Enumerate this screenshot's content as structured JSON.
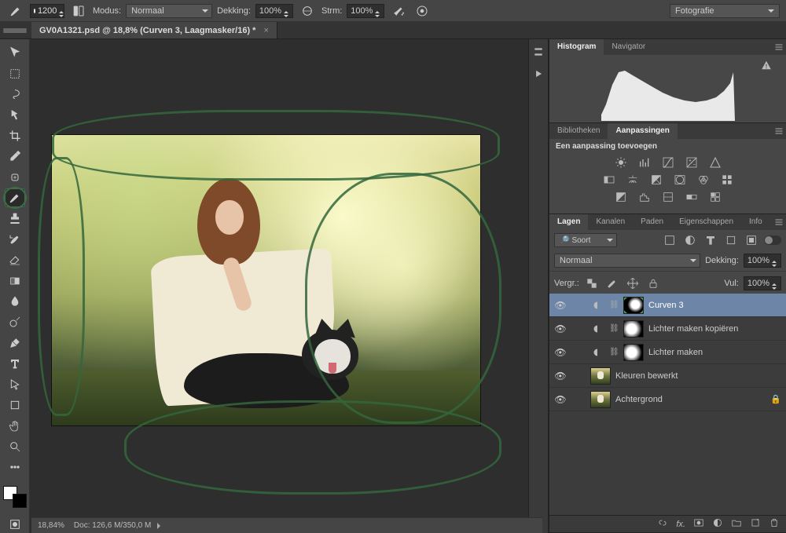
{
  "topbar": {
    "brush_size": "1200",
    "modus_label": "Modus:",
    "modus_value": "Normaal",
    "dekking_label": "Dekking:",
    "dekking_value": "100%",
    "strm_label": "Strm:",
    "strm_value": "100%",
    "workspace": "Fotografie"
  },
  "doc": {
    "tab_title": "GV0A1321.psd @ 18,8% (Curven 3, Laagmasker/16) *"
  },
  "status": {
    "zoom": "18,84%",
    "docinfo_label": "Doc:",
    "docinfo_value": "126,6 M/350,0 M"
  },
  "panels": {
    "histogram": {
      "tab_hist": "Histogram",
      "tab_nav": "Navigator"
    },
    "adjust": {
      "tab_bib": "Bibliotheken",
      "tab_aan": "Aanpassingen",
      "title": "Een aanpassing toevoegen"
    },
    "layers": {
      "tab_lagen": "Lagen",
      "tab_kanalen": "Kanalen",
      "tab_paden": "Paden",
      "tab_eig": "Eigenschappen",
      "tab_info": "Info",
      "filter_label": "Soort",
      "blend_label": "Normaal",
      "dekking_label": "Dekking:",
      "dekking_value": "100%",
      "vergr_label": "Vergr.:",
      "vul_label": "Vul:",
      "vul_value": "100%",
      "items": [
        {
          "name": "Curven 3"
        },
        {
          "name": "Lichter maken kopiëren"
        },
        {
          "name": "Lichter maken"
        },
        {
          "name": "Kleuren bewerkt"
        },
        {
          "name": "Achtergrond"
        }
      ]
    }
  }
}
